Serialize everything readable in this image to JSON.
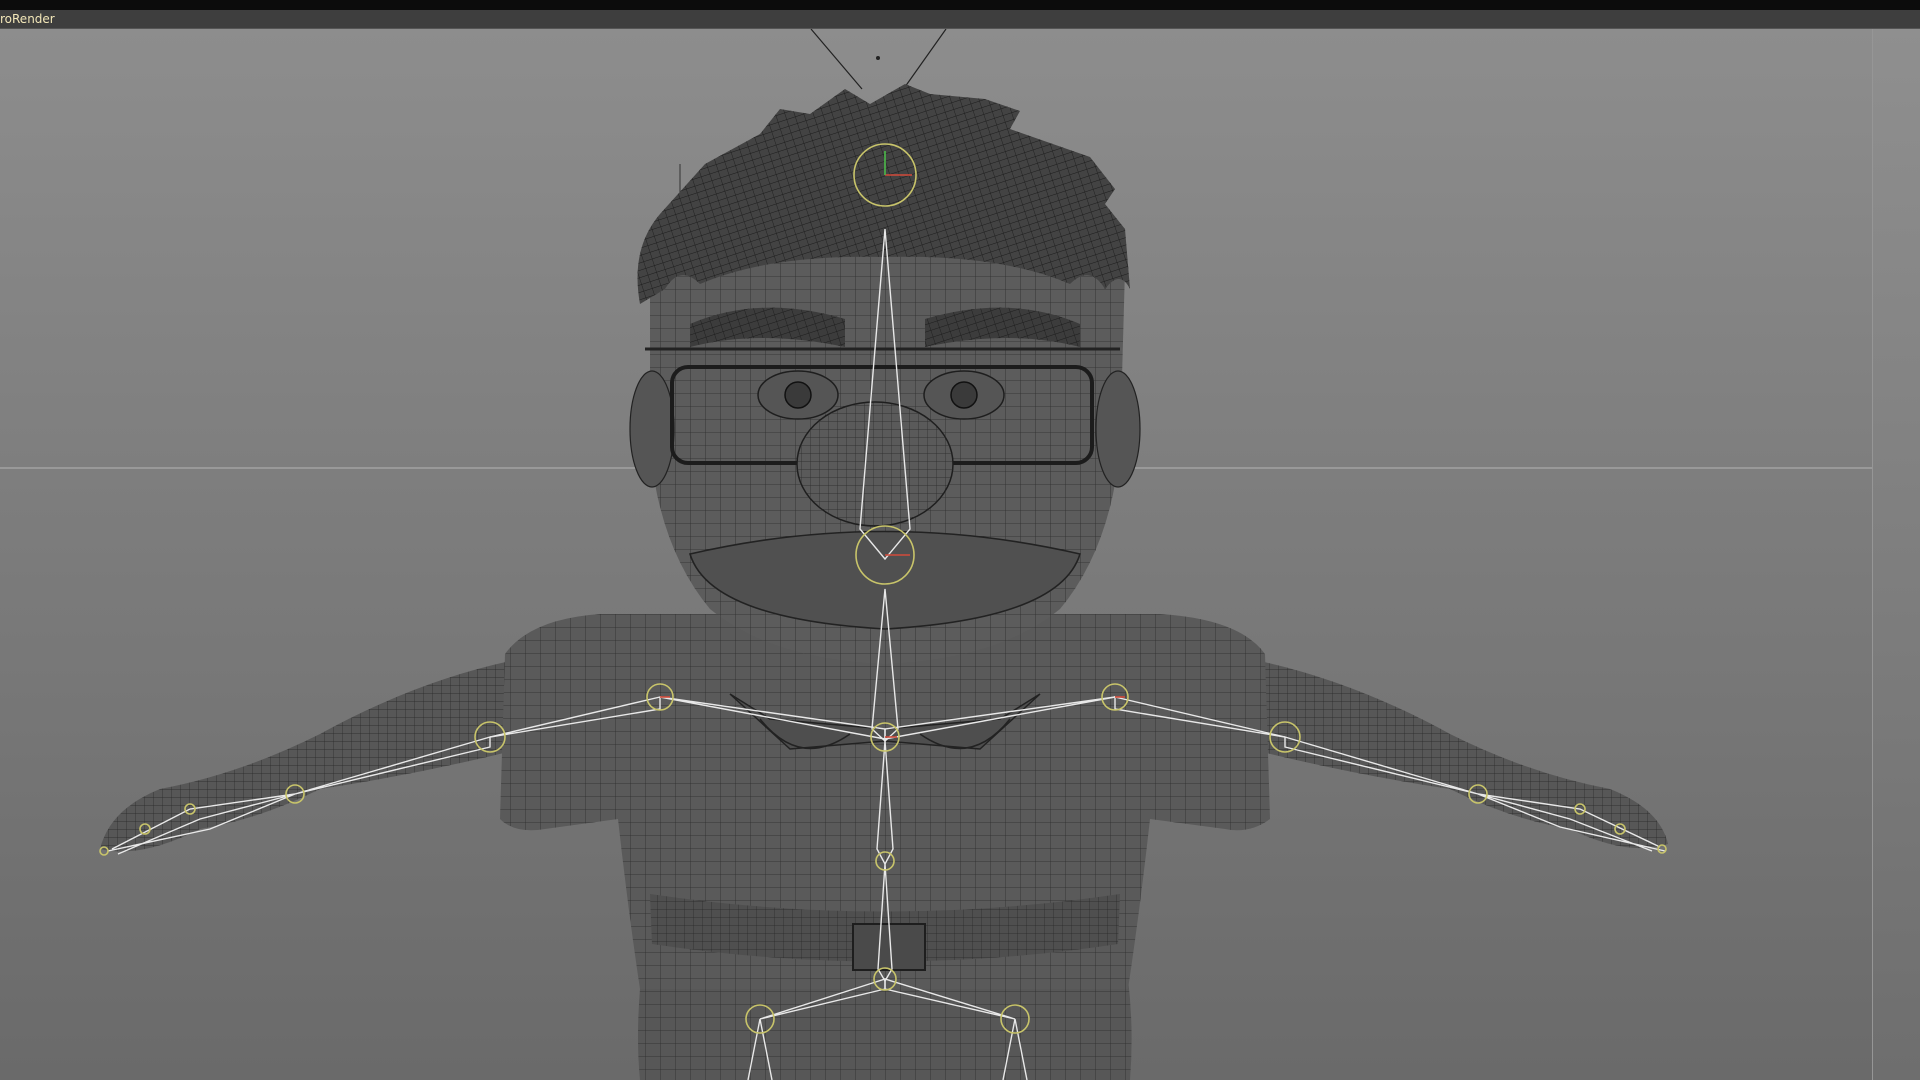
{
  "viewport": {
    "renderer_label": "roRender"
  },
  "colors": {
    "mesh_fill": "#585858",
    "wire": "#262626",
    "bone": "#e8e8e8",
    "joint": "#c8c46a",
    "joint_accent": "#d24a3a"
  },
  "scene": {
    "object": "character-rig",
    "skeleton_joints": [
      "head-top",
      "jaw",
      "shoulder-left",
      "shoulder-right",
      "neck",
      "elbow-left",
      "elbow-right",
      "wrist-left",
      "wrist-right",
      "spine",
      "hips",
      "hip-left",
      "hip-right"
    ]
  }
}
